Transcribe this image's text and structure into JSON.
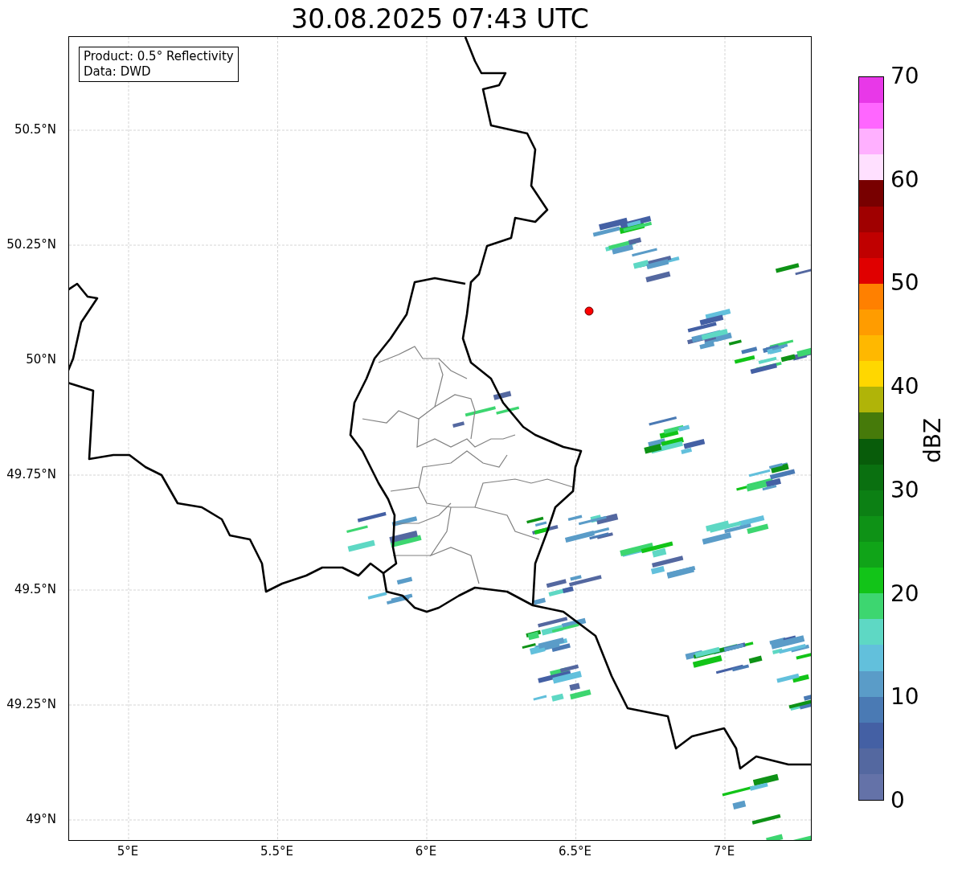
{
  "title": "30.08.2025 07:43 UTC",
  "info_box": {
    "lines": [
      "Product: 0.5° Reflectivity",
      "Data: DWD"
    ]
  },
  "map": {
    "y_ticks": [
      "50.5°N",
      "50.25°N",
      "50°N",
      "49.75°N",
      "49.5°N",
      "49.25°N",
      "49°N"
    ],
    "x_ticks": [
      "5°E",
      "5.5°E",
      "6°E",
      "6.5°E",
      "7°E"
    ]
  },
  "colorbar": {
    "label": "dBZ",
    "ticks": [
      "70",
      "60",
      "50",
      "40",
      "30",
      "20",
      "10",
      "0"
    ],
    "bins": [
      {
        "color": "#e838e8"
      },
      {
        "color": "#ff66ff"
      },
      {
        "color": "#ffb0ff"
      },
      {
        "color": "#ffe0ff"
      },
      {
        "color": "#780000"
      },
      {
        "color": "#a00000"
      },
      {
        "color": "#c00000"
      },
      {
        "color": "#e00000"
      },
      {
        "color": "#ff8000"
      },
      {
        "color": "#ff9c00"
      },
      {
        "color": "#ffb800"
      },
      {
        "color": "#ffd700"
      },
      {
        "color": "#b0b408"
      },
      {
        "color": "#467a0a"
      },
      {
        "color": "#085c0a"
      },
      {
        "color": "#0a7010"
      },
      {
        "color": "#0c8014"
      },
      {
        "color": "#0e9216"
      },
      {
        "color": "#10a418"
      },
      {
        "color": "#12c418"
      },
      {
        "color": "#3dd670"
      },
      {
        "color": "#5ed8c4"
      },
      {
        "color": "#62c0dc"
      },
      {
        "color": "#5a9cc8"
      },
      {
        "color": "#4a7ab4"
      },
      {
        "color": "#4460a4"
      },
      {
        "color": "#5468a0"
      },
      {
        "color": "#6472a8"
      }
    ]
  }
}
